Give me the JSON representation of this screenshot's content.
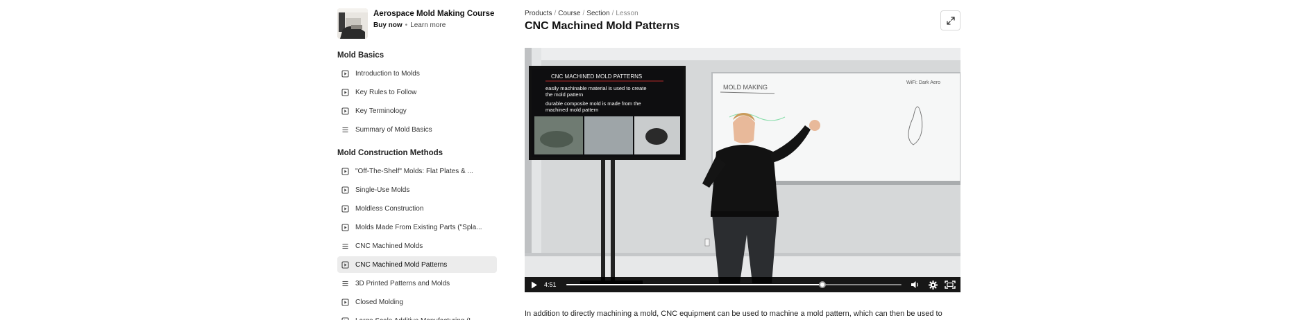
{
  "course": {
    "title": "Aerospace Mold Making Course",
    "buy_label": "Buy now",
    "separator": "•",
    "learn_label": "Learn more"
  },
  "sections": [
    {
      "title": "Mold Basics",
      "lessons": [
        {
          "label": "Introduction to Molds",
          "type": "video"
        },
        {
          "label": "Key Rules to Follow",
          "type": "video"
        },
        {
          "label": "Key Terminology",
          "type": "video"
        },
        {
          "label": "Summary of Mold Basics",
          "type": "text"
        }
      ]
    },
    {
      "title": "Mold Construction Methods",
      "lessons": [
        {
          "label": "\"Off-The-Shelf\" Molds: Flat Plates & ...",
          "type": "video"
        },
        {
          "label": "Single-Use Molds",
          "type": "video"
        },
        {
          "label": "Moldless Construction",
          "type": "video"
        },
        {
          "label": "Molds Made From Existing Parts (\"Spla...",
          "type": "video"
        },
        {
          "label": "CNC Machined Molds",
          "type": "text"
        },
        {
          "label": "CNC Machined Mold Patterns",
          "type": "video",
          "active": true
        },
        {
          "label": "3D Printed Patterns and Molds",
          "type": "text"
        },
        {
          "label": "Closed Molding",
          "type": "video"
        },
        {
          "label": "Large Scale Additive Manufacturing (L...",
          "type": "video"
        }
      ]
    }
  ],
  "breadcrumb": {
    "items": [
      "Products",
      "Course",
      "Section",
      "Lesson"
    ],
    "separator": "/"
  },
  "lesson": {
    "title": "CNC Machined Mold Patterns"
  },
  "video": {
    "slide_title": "CNC MACHINED MOLD PATTERNS",
    "slide_lines": [
      "easily machinable material is used to create",
      "the mold pattern",
      "durable composite mold is made from the",
      "machined mold pattern"
    ],
    "whiteboard_heading": "MOLD MAKING",
    "whiteboard_note": "WiFi: Dark Aero",
    "time": "4:51",
    "progress": 0.765
  },
  "body": {
    "text": "In addition to directly machining a mold, CNC equipment can be used to machine a mold pattern, which can then be used to"
  },
  "icons": {
    "lesson_video": "play-square-icon",
    "lesson_text": "text-lines-icon",
    "expand": "expand-arrows-icon",
    "play": "play-icon",
    "volume": "volume-icon",
    "settings": "gear-icon",
    "fullscreen": "fullscreen-icon"
  },
  "colors": {
    "active_lesson_bg": "#ececec",
    "control_bar": "#000000"
  }
}
